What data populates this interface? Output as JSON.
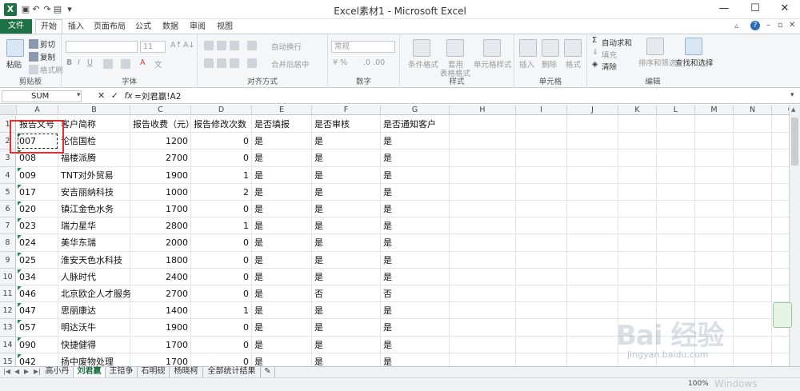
{
  "window": {
    "title": "Excel素材1 - Microsoft Excel",
    "app_icon": "X"
  },
  "ribbon_tabs": [
    "文件",
    "开始",
    "插入",
    "页面布局",
    "公式",
    "数据",
    "审阅",
    "视图"
  ],
  "ribbon": {
    "clipboard": {
      "label": "剪贴板",
      "paste": "粘贴",
      "cut": "剪切",
      "copy": "复制",
      "format_painter": "格式刷"
    },
    "font": {
      "label": "字体",
      "size": "11"
    },
    "alignment": {
      "label": "对齐方式",
      "wrap": "自动换行",
      "merge": "合并后居中"
    },
    "number": {
      "label": "数字",
      "format": "常规"
    },
    "styles": {
      "label": "样式",
      "conditional": "条件格式",
      "table": "套用",
      "table2": "表格格式",
      "cell_styles": "单元格样式"
    },
    "cells": {
      "label": "单元格",
      "insert": "插入",
      "delete": "删除",
      "format": "格式"
    },
    "editing": {
      "label": "编辑",
      "autosum": "自动求和",
      "fill": "填充",
      "clear": "清除",
      "sort": "排序和筛选",
      "find": "查找和选择"
    }
  },
  "formula_bar": {
    "name_box": "SUM",
    "formula": "=刘君嬴!A2",
    "fx": "fx"
  },
  "columns": [
    "A",
    "B",
    "C",
    "D",
    "E",
    "F",
    "G",
    "H",
    "I",
    "J",
    "K",
    "L",
    "M",
    "N",
    "O"
  ],
  "header_row": [
    "报告文号",
    "客户简称",
    "报告收费（元）",
    "报告修改次数",
    "是否填报",
    "是否审核",
    "是否通知客户"
  ],
  "rows": [
    [
      "1"
    ],
    [
      "2",
      "007",
      "论信国检",
      "1200",
      "0",
      "是",
      "是",
      "是"
    ],
    [
      "3",
      "008",
      "福楼派腾",
      "2700",
      "0",
      "是",
      "是",
      "是"
    ],
    [
      "4",
      "009",
      "TNT对外贸易",
      "1900",
      "1",
      "是",
      "是",
      "是"
    ],
    [
      "5",
      "017",
      "安吉丽纳科技",
      "1000",
      "2",
      "是",
      "是",
      "是"
    ],
    [
      "6",
      "020",
      "镇江金色水务",
      "1700",
      "0",
      "是",
      "是",
      "是"
    ],
    [
      "7",
      "023",
      "瑞力星华",
      "2800",
      "1",
      "是",
      "是",
      "是"
    ],
    [
      "8",
      "024",
      "美华东瑞",
      "2000",
      "0",
      "是",
      "是",
      "是"
    ],
    [
      "9",
      "025",
      "淮安天色水科技",
      "1800",
      "0",
      "是",
      "是",
      "是"
    ],
    [
      "10",
      "034",
      "人脉时代",
      "2400",
      "0",
      "是",
      "是",
      "是"
    ],
    [
      "11",
      "046",
      "北京欧企人才服务",
      "2700",
      "0",
      "是",
      "否",
      "否"
    ],
    [
      "12",
      "047",
      "思丽康达",
      "1400",
      "1",
      "是",
      "是",
      "是"
    ],
    [
      "13",
      "057",
      "明达沃牛",
      "1900",
      "0",
      "是",
      "是",
      "是"
    ],
    [
      "14",
      "090",
      "快捷健得",
      "1700",
      "0",
      "是",
      "是",
      "是"
    ],
    [
      "15",
      "042",
      "扬中废物处理",
      "1700",
      "0",
      "是",
      "是",
      "是"
    ]
  ],
  "sheet_tabs": [
    "高小丹",
    "刘君嬴",
    "王锫争",
    "石明砚",
    "杨晓柯",
    "全部统计结果"
  ],
  "active_sheet": "刘君嬴",
  "status": {
    "zoom": "100%"
  },
  "watermark": {
    "main": "Bai 经验",
    "url": "jingyan.baidu.com",
    "os": "Windows"
  }
}
